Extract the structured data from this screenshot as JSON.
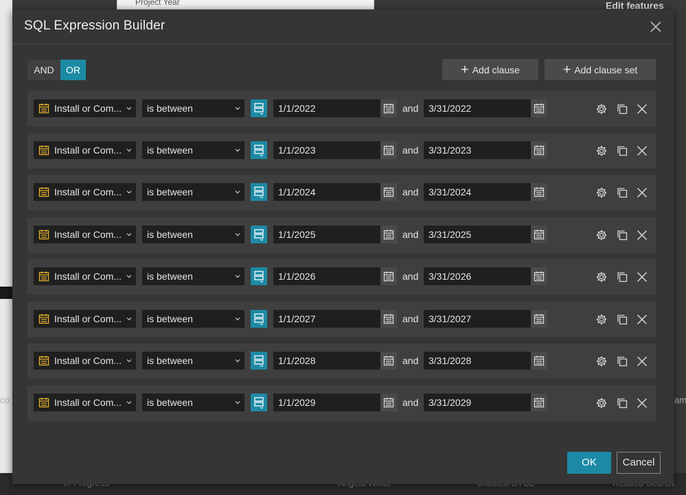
{
  "background": {
    "top_field_label": "Project Year",
    "right_header": "Edit features",
    "bottom_items": [
      "In Progress",
      "Angela White",
      "Unlisted SYCL",
      "Related Search"
    ],
    "side_left": "co...",
    "side_right": "am"
  },
  "dialog": {
    "title": "SQL Expression Builder",
    "close_icon": "close-icon",
    "logic": {
      "and_label": "AND",
      "or_label": "OR",
      "selected": "OR"
    },
    "add_clause_label": "Add clause",
    "add_clause_set_label": "Add clause set",
    "ok_label": "OK",
    "cancel_label": "Cancel",
    "accent_color": "#1d8aa5",
    "field_icon_color": "#e8b22e"
  },
  "clauses": [
    {
      "field": "Install or Com...",
      "operator": "is between",
      "start": "1/1/2022",
      "joiner": "and",
      "end": "3/31/2022"
    },
    {
      "field": "Install or Com...",
      "operator": "is between",
      "start": "1/1/2023",
      "joiner": "and",
      "end": "3/31/2023"
    },
    {
      "field": "Install or Com...",
      "operator": "is between",
      "start": "1/1/2024",
      "joiner": "and",
      "end": "3/31/2024"
    },
    {
      "field": "Install or Com...",
      "operator": "is between",
      "start": "1/1/2025",
      "joiner": "and",
      "end": "3/31/2025"
    },
    {
      "field": "Install or Com...",
      "operator": "is between",
      "start": "1/1/2026",
      "joiner": "and",
      "end": "3/31/2026"
    },
    {
      "field": "Install or Com...",
      "operator": "is between",
      "start": "1/1/2027",
      "joiner": "and",
      "end": "3/31/2027"
    },
    {
      "field": "Install or Com...",
      "operator": "is between",
      "start": "1/1/2028",
      "joiner": "and",
      "end": "3/31/2028"
    },
    {
      "field": "Install or Com...",
      "operator": "is between",
      "start": "1/1/2029",
      "joiner": "and",
      "end": "3/31/2029"
    }
  ]
}
